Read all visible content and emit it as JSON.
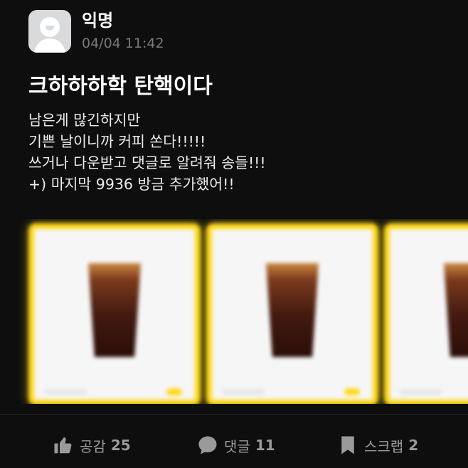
{
  "post": {
    "author": "익명",
    "timestamp": "04/04 11:42",
    "title": "크하하하학 탄핵이다",
    "body_lines": [
      "남은게 많긴하지만",
      "기쁜 날이니까 커피 쏜다!!!!!",
      "쓰거나 다운받고 댓글로 알려줘 송들!!!",
      "+) 마지막 9936 방금 추가했어!!"
    ],
    "images": [
      {
        "alt": "iced-americano-coupon"
      },
      {
        "alt": "iced-americano-coupon"
      },
      {
        "alt": "iced-americano-coupon"
      }
    ]
  },
  "actions": {
    "like": {
      "label": "공감",
      "count": "25",
      "icon": "thumbs-up-icon"
    },
    "comment": {
      "label": "댓글",
      "count": "11",
      "icon": "speech-bubble-icon"
    },
    "scrap": {
      "label": "스크랩",
      "count": "2",
      "icon": "bookmark-icon"
    }
  },
  "colors": {
    "background": "#0e0e0e",
    "accent_yellow": "#ffd91a",
    "muted_text": "#9a9a9a"
  }
}
